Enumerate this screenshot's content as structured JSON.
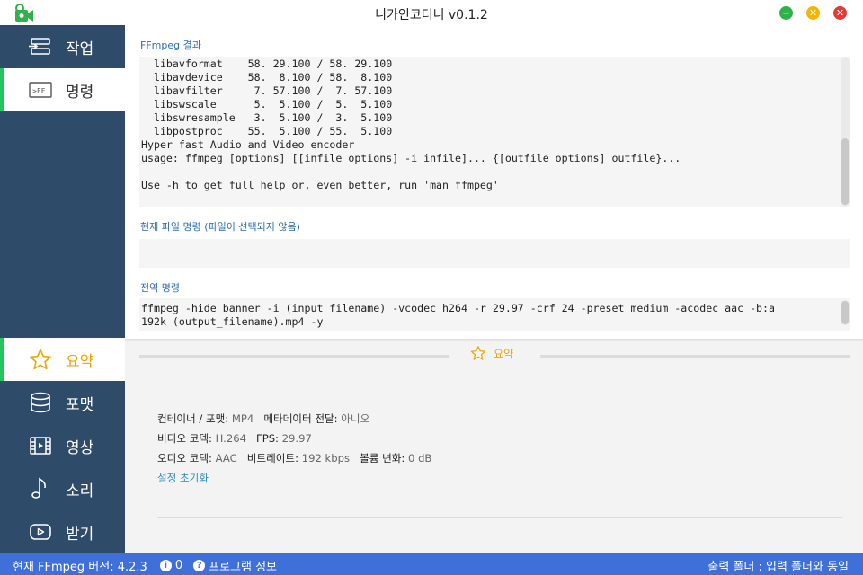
{
  "window": {
    "title": "니가인코더니 v0.1.2",
    "controls": {
      "minimize": "−",
      "maximize": "✕",
      "close": "✕"
    }
  },
  "sidebar": {
    "top_items": [
      {
        "label": "작업",
        "icon": "tasks-icon"
      },
      {
        "label": "명령",
        "icon": "ffmpeg-command-icon",
        "active": true
      }
    ],
    "bottom_items": [
      {
        "label": "요약",
        "icon": "star-icon",
        "active": true
      },
      {
        "label": "포맷",
        "icon": "database-icon"
      },
      {
        "label": "영상",
        "icon": "film-icon"
      },
      {
        "label": "소리",
        "icon": "music-note-icon"
      },
      {
        "label": "받기",
        "icon": "play-icon"
      }
    ]
  },
  "main": {
    "ffmpeg_result_label": "FFmpeg 결과",
    "ffmpeg_result_text": "  libavformat    58. 29.100 / 58. 29.100\n  libavdevice    58.  8.100 / 58.  8.100\n  libavfilter     7. 57.100 /  7. 57.100\n  libswscale      5.  5.100 /  5.  5.100\n  libswresample   3.  5.100 /  3.  5.100\n  libpostproc    55.  5.100 / 55.  5.100\nHyper fast Audio and Video encoder\nusage: ffmpeg [options] [[infile options] -i infile]... {[outfile options] outfile}...\n\nUse -h to get full help or, even better, run 'man ffmpeg'",
    "current_command_label": "현재 파일 명령 (파일이 선택되지 않음)",
    "current_command_text": "",
    "global_command_label": "전역 명령",
    "global_command_text": "ffmpeg -hide_banner -i (input_filename) -vcodec h264 -r 29.97 -crf 24 -preset medium -acodec aac -b:a\n192k (output_filename).mp4 -y"
  },
  "summary": {
    "title": "요약",
    "container_key": "컨테이너 / 포맷:",
    "container_val": "MP4",
    "metadata_key": "메타데이터 전달:",
    "metadata_val": "아니오",
    "vcodec_key": "비디오 코덱:",
    "vcodec_val": "H.264",
    "fps_key": "FPS:",
    "fps_val": "29.97",
    "acodec_key": "오디오 코덱:",
    "acodec_val": "AAC",
    "bitrate_key": "비트레이트:",
    "bitrate_val": "192 kbps",
    "volume_key": "볼륨 변화:",
    "volume_val": "0 dB",
    "reset_label": "설정 초기화"
  },
  "statusbar": {
    "ffmpeg_version": "현재 FFmpeg 버전: 4.2.3",
    "info_count": "0",
    "program_info": "프로그램 정보",
    "output_folder": "출력 폴더 : 입력 폴더와 동일"
  },
  "colors": {
    "sidebar_bg": "#2e4b6a",
    "accent_green": "#22c55e",
    "accent_yellow": "#f0a500",
    "label_blue": "#2a6db5",
    "statusbar_bg": "#3f6fd8"
  }
}
